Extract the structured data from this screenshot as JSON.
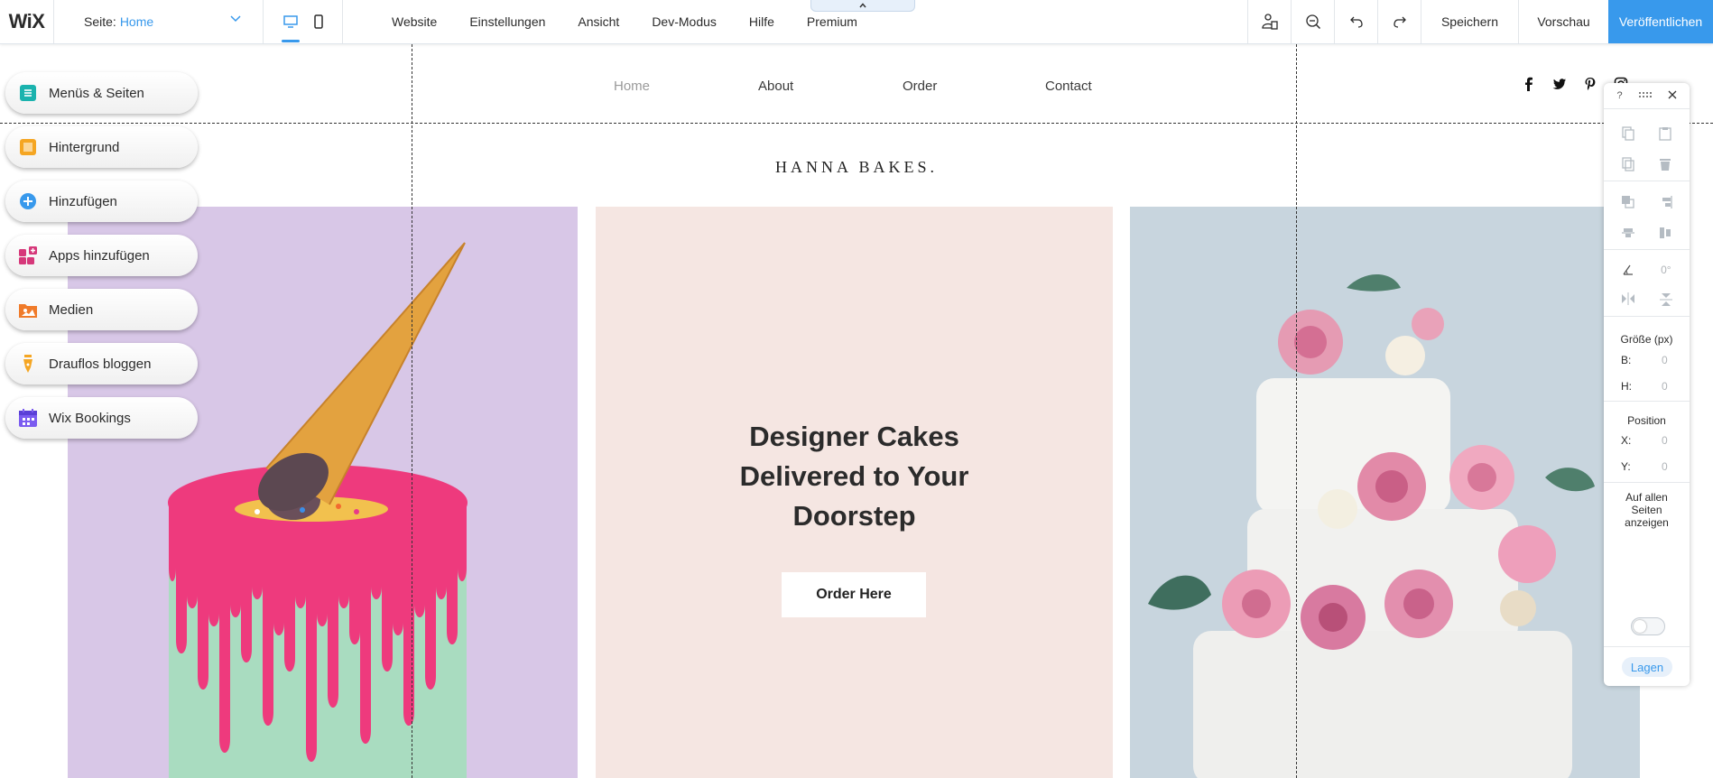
{
  "topbar": {
    "logo": "WiX",
    "page_select": {
      "label": "Seite:",
      "value": "Home"
    },
    "menu": [
      "Website",
      "Einstellungen",
      "Ansicht",
      "Dev-Modus",
      "Hilfe",
      "Premium"
    ],
    "save_label": "Speichern",
    "preview_label": "Vorschau",
    "publish_label": "Veröffentlichen",
    "accent_color": "#3899ec"
  },
  "left_panel": {
    "items": [
      {
        "label": "Menüs & Seiten",
        "icon": "pages-icon",
        "color": "#1bb3ae"
      },
      {
        "label": "Hintergrund",
        "icon": "background-icon",
        "color": "#f5a623"
      },
      {
        "label": "Hinzufügen",
        "icon": "add-icon",
        "color": "#3899ec"
      },
      {
        "label": "Apps hinzufügen",
        "icon": "apps-icon",
        "color": "#d6387a"
      },
      {
        "label": "Medien",
        "icon": "media-icon",
        "color": "#f07b2a"
      },
      {
        "label": "Drauflos bloggen",
        "icon": "blog-pen-icon",
        "color": "#f5a623"
      },
      {
        "label": "Wix Bookings",
        "icon": "bookings-calendar-icon",
        "color": "#7b5cf0"
      }
    ]
  },
  "site": {
    "nav": [
      "Home",
      "About",
      "Order",
      "Contact"
    ],
    "social": [
      "facebook-icon",
      "twitter-icon",
      "pinterest-icon",
      "instagram-icon"
    ],
    "title": "HANNA BAKES.",
    "hero_title_lines": [
      "Designer Cakes",
      "Delivered to Your",
      "Doorstep"
    ],
    "cta_label": "Order Here"
  },
  "right_toolbar": {
    "size_title": "Größe (px)",
    "width_label": "B:",
    "width_value": "0",
    "height_label": "H:",
    "height_value": "0",
    "rotation_value": "0°",
    "position_title": "Position",
    "x_label": "X:",
    "x_value": "0",
    "y_label": "Y:",
    "y_value": "0",
    "all_pages_label": "Auf allen Seiten anzeigen",
    "layers_label": "Lagen",
    "help_label": "?"
  }
}
